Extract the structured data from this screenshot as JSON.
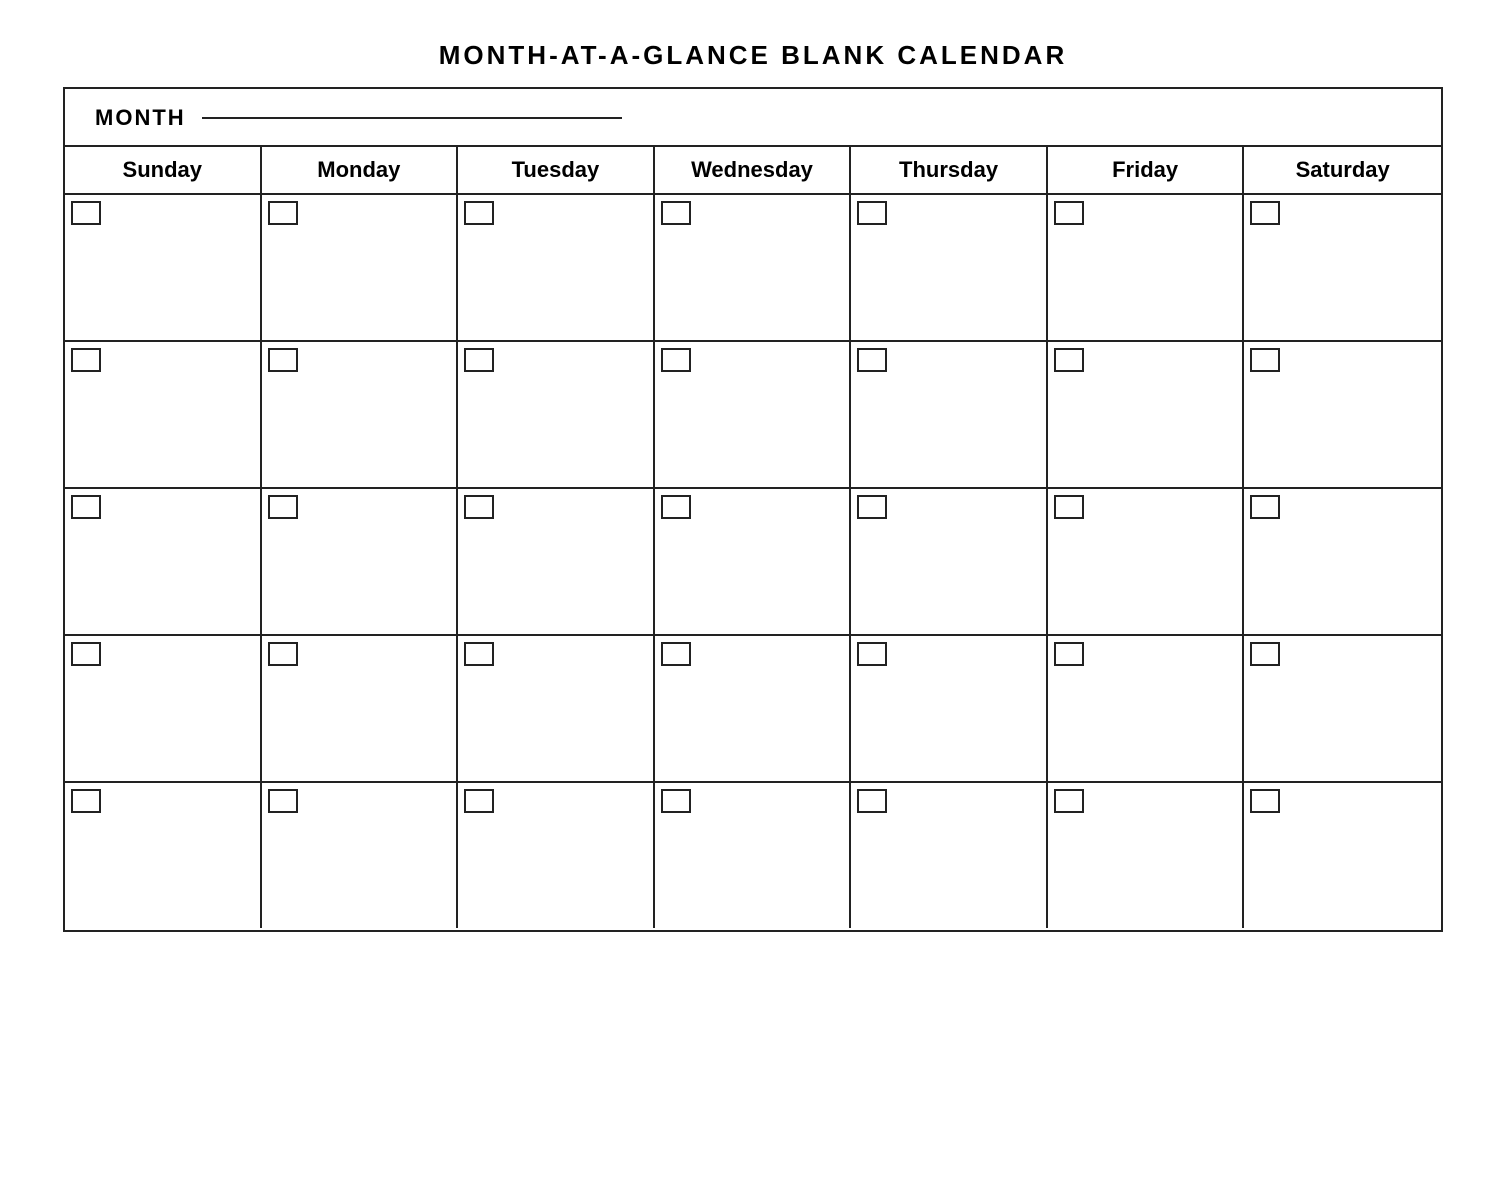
{
  "title": "MONTH-AT-A-GLANCE  BLANK  CALENDAR",
  "month_label": "MONTH",
  "days": [
    "Sunday",
    "Monday",
    "Tuesday",
    "Wednesday",
    "Thursday",
    "Friday",
    "Saturday"
  ],
  "rows": 5
}
